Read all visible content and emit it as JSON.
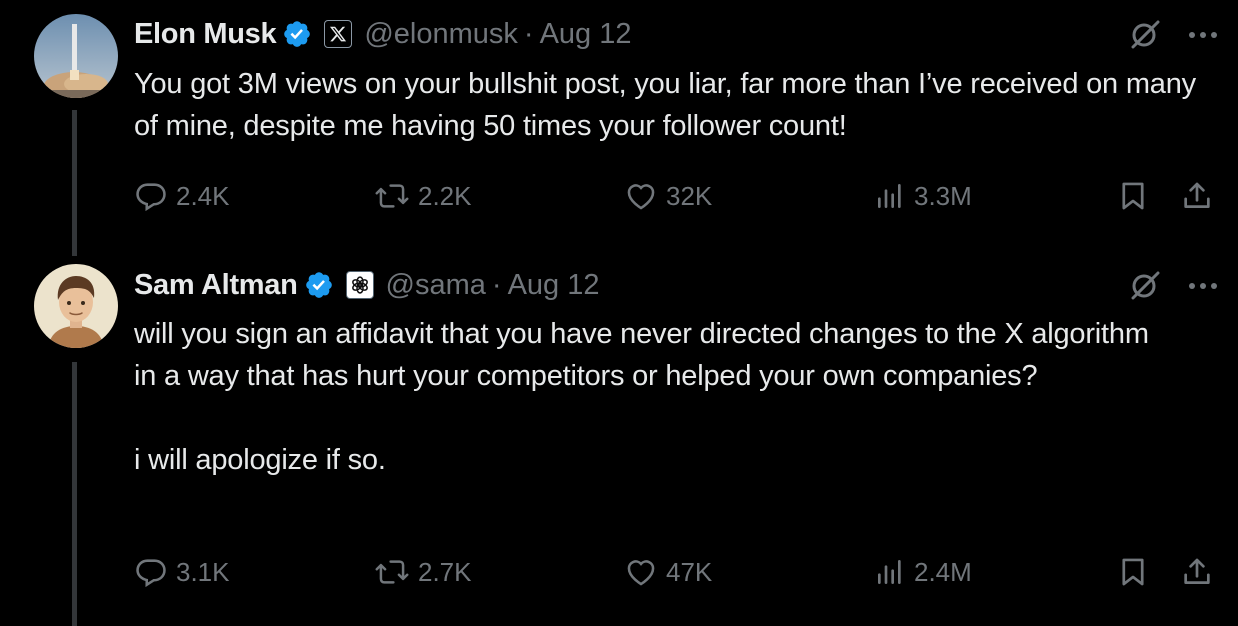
{
  "tweets": [
    {
      "name": "Elon Musk",
      "handle": "@elonmusk",
      "separator": "·",
      "date": "Aug 12",
      "affiliation_icon": "x-logo-badge",
      "avatar": "rocket-launch-avatar",
      "text": [
        "You got 3M views on your bullshit post, you liar, far more than I’ve received on many of mine, despite me having 50 times your follower count!"
      ],
      "replies": "2.4K",
      "reposts": "2.2K",
      "likes": "32K",
      "views": "3.3M"
    },
    {
      "name": "Sam Altman",
      "handle": "@sama",
      "separator": "·",
      "date": "Aug 12",
      "affiliation_icon": "openai-logo-badge",
      "avatar": "cartoon-portrait-avatar",
      "text": [
        "will you sign an affidavit that you have never directed changes to the X algorithm in a way that has hurt your competitors or helped your own companies?",
        "i will apologize if so."
      ],
      "replies": "3.1K",
      "reposts": "2.7K",
      "likes": "47K",
      "views": "2.4M"
    }
  ],
  "colors": {
    "background": "#000000",
    "text": "#e7e9ea",
    "muted": "#71767b",
    "verified": "#1d9bf0",
    "thread_line": "#333639"
  }
}
